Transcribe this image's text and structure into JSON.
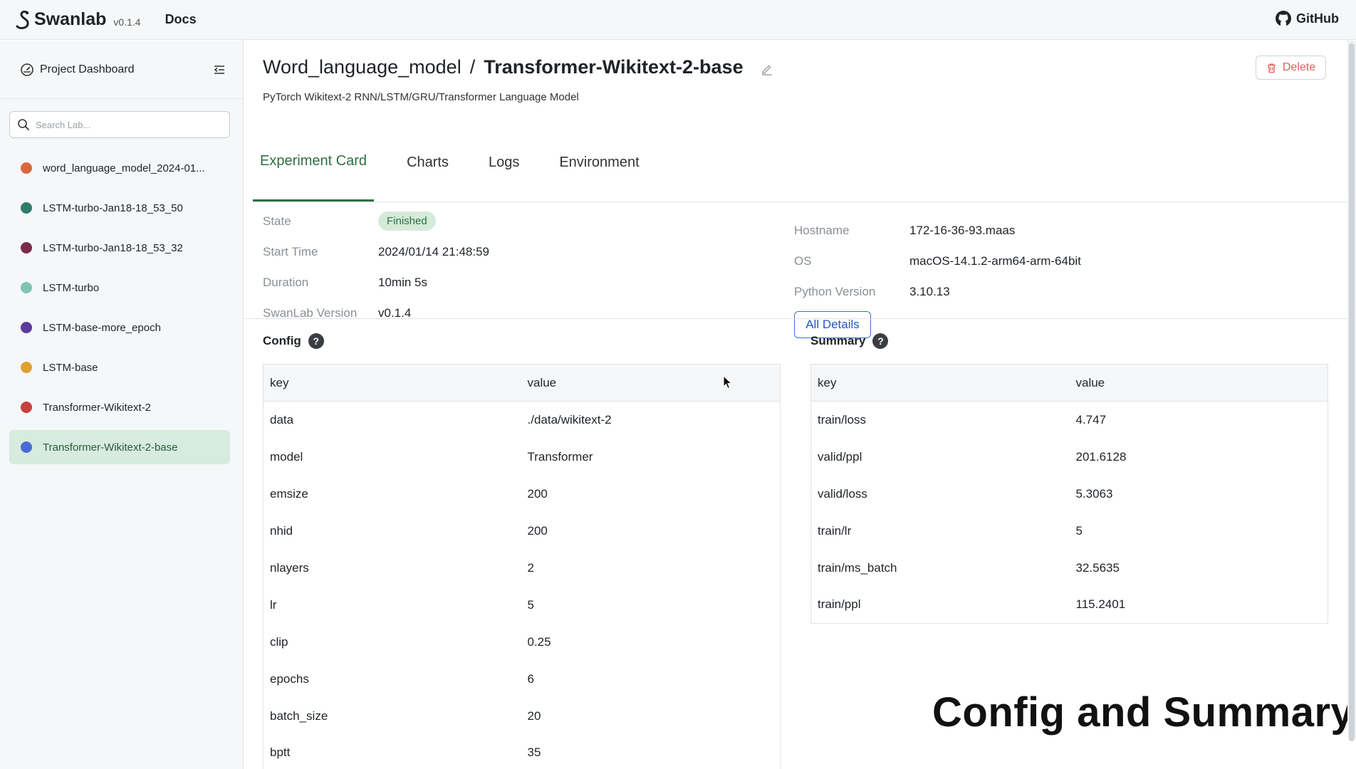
{
  "app": {
    "name": "Swanlab",
    "version": "v0.1.4",
    "docs_label": "Docs",
    "github_label": "GitHub"
  },
  "sidebar": {
    "title": "Project Dashboard",
    "search_placeholder": "Search Lab...",
    "items": [
      {
        "label": "word_language_model_2024-01...",
        "color": "#d9683c"
      },
      {
        "label": "LSTM-turbo-Jan18-18_53_50",
        "color": "#2e7d6b"
      },
      {
        "label": "LSTM-turbo-Jan18-18_53_32",
        "color": "#7a2b48"
      },
      {
        "label": "LSTM-turbo",
        "color": "#7fc4b6"
      },
      {
        "label": "LSTM-base-more_epoch",
        "color": "#5b3c9e"
      },
      {
        "label": "LSTM-base",
        "color": "#e0a130"
      },
      {
        "label": "Transformer-Wikitext-2",
        "color": "#c9403f"
      },
      {
        "label": "Transformer-Wikitext-2-base",
        "color": "#4a6ad8"
      }
    ]
  },
  "header": {
    "project": "Word_language_model",
    "separator": "/",
    "experiment": "Transformer-Wikitext-2-base",
    "description": "PyTorch Wikitext-2 RNN/LSTM/GRU/Transformer Language Model",
    "delete_label": "Delete"
  },
  "tabs": [
    "Experiment Card",
    "Charts",
    "Logs",
    "Environment"
  ],
  "info_left": [
    {
      "key": "State",
      "value": "Finished"
    },
    {
      "key": "Start Time",
      "value": "2024/01/14 21:48:59"
    },
    {
      "key": "Duration",
      "value": "10min 5s"
    },
    {
      "key": "SwanLab Version",
      "value": "v0.1.4"
    }
  ],
  "info_right": [
    {
      "key": "Hostname",
      "value": "172-16-36-93.maas"
    },
    {
      "key": "OS",
      "value": "macOS-14.1.2-arm64-arm-64bit"
    },
    {
      "key": "Python Version",
      "value": "3.10.13"
    }
  ],
  "all_details_label": "All Details",
  "config": {
    "title": "Config",
    "help": "?",
    "headers": [
      "key",
      "value"
    ],
    "rows": [
      [
        "data",
        "./data/wikitext-2"
      ],
      [
        "model",
        "Transformer"
      ],
      [
        "emsize",
        "200"
      ],
      [
        "nhid",
        "200"
      ],
      [
        "nlayers",
        "2"
      ],
      [
        "lr",
        "5"
      ],
      [
        "clip",
        "0.25"
      ],
      [
        "epochs",
        "6"
      ],
      [
        "batch_size",
        "20"
      ],
      [
        "bptt",
        "35"
      ]
    ]
  },
  "summary": {
    "title": "Summary",
    "help": "?",
    "headers": [
      "key",
      "value"
    ],
    "rows": [
      [
        "train/loss",
        "4.747"
      ],
      [
        "valid/ppl",
        "201.6128"
      ],
      [
        "valid/loss",
        "5.3063"
      ],
      [
        "train/lr",
        "5"
      ],
      [
        "train/ms_batch",
        "32.5635"
      ],
      [
        "train/ppl",
        "115.2401"
      ]
    ]
  },
  "caption": "Config and Summary",
  "colors": {
    "accent_green": "#2f6f43",
    "active_bg": "#d7ebde",
    "link_blue": "#2457c5",
    "danger": "#e45a5a"
  }
}
